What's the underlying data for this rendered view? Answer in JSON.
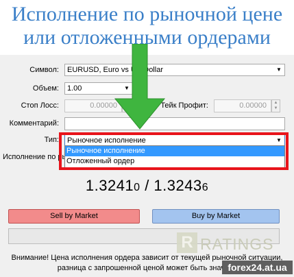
{
  "banner": {
    "line1": "Исполнение по рыночной цене",
    "line2": "или отложенными ордерами"
  },
  "form": {
    "symbol_label": "Символ:",
    "symbol_value": "EURUSD, Euro vs US Dollar",
    "volume_label": "Объем:",
    "volume_value": "1.00",
    "stop_loss_label": "Стоп Лосс:",
    "stop_loss_value": "0.00000",
    "take_profit_label": "Тейк Профит:",
    "take_profit_value": "0.00000",
    "comment_label": "Комментарий:",
    "comment_value": "",
    "type_label": "Тип:",
    "type_value": "Рыночное исполнение",
    "type_options": [
      "Рыночное исполнение",
      "Отложенный ордер"
    ],
    "execution_label": "Исполнение по ры"
  },
  "quotes": {
    "bid_main": "1.3241",
    "bid_small": "0",
    "separator": " / ",
    "ask_main": "1.3243",
    "ask_small": "6"
  },
  "buttons": {
    "sell": "Sell by Market",
    "buy": "Buy by Market"
  },
  "progress": {
    "value": 0
  },
  "warning": {
    "line1": "Внимание! Цена исполнения ордера зависит от текущей рыночной ситуации,",
    "line2": "разница с запрошенной ценой может быть значите"
  },
  "watermark": {
    "logo_letter": "R",
    "text": "RATINGS",
    "site": "forex24.at.ua"
  },
  "colors": {
    "banner_text": "#3a7fc8",
    "highlight_frame": "#e8141b",
    "arrow": "#3fb53f",
    "sell": "#f28b8b",
    "buy": "#a3c4ef",
    "selected_option": "#3399ff"
  }
}
